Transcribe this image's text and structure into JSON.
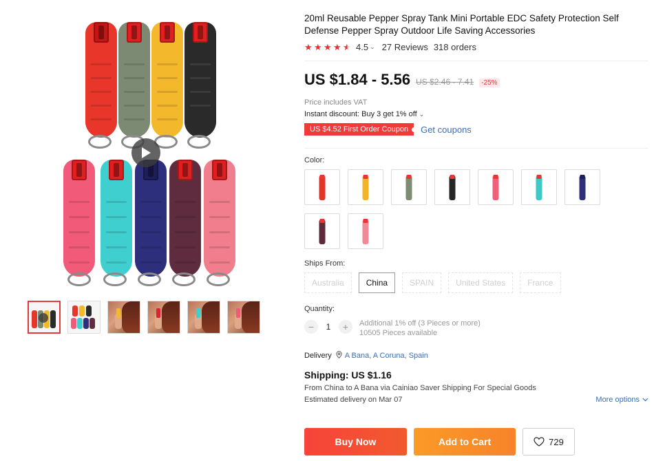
{
  "product": {
    "title": "20ml Reusable Pepper Spray Tank Mini Portable EDC Safety Protection Self Defense Pepper Spray Outdoor Life Saving Accessories",
    "rating": "4.5",
    "rating_stars": 4.5,
    "reviews": "27 Reviews",
    "orders": "318 orders"
  },
  "pricing": {
    "price": "US $1.84 - 5.56",
    "old_price": "US $2.46 - 7.41",
    "discount": "-25%",
    "vat_note": "Price includes VAT",
    "instant_discount": "Instant discount: Buy 3 get 1% off",
    "coupon": "US $4.52 First Order Coupon",
    "get_coupons": "Get coupons"
  },
  "color": {
    "label": "Color:",
    "options": [
      {
        "name": "red",
        "body": "#e3342a"
      },
      {
        "name": "yellow",
        "body": "#f2b52a"
      },
      {
        "name": "gray-green",
        "body": "#7f8a72"
      },
      {
        "name": "black",
        "body": "#262626"
      },
      {
        "name": "pink",
        "body": "#f0607a"
      },
      {
        "name": "turquoise",
        "body": "#3ec9c9"
      },
      {
        "name": "navy",
        "body": "#2e317a"
      },
      {
        "name": "plum",
        "body": "#5c2a3a"
      },
      {
        "name": "light-pink",
        "body": "#f08a96"
      }
    ]
  },
  "ships_from": {
    "label": "Ships From:",
    "options": [
      "Australia",
      "China",
      "SPAIN",
      "United States",
      "France"
    ],
    "selected": "China"
  },
  "quantity": {
    "label": "Quantity:",
    "value": "1",
    "minus": "−",
    "plus": "+",
    "additional": "Additional 1% off (3 Pieces or more)",
    "available": "10505 Pieces available"
  },
  "delivery": {
    "label": "Delivery",
    "destination": "A Bana, A Coruna, Spain",
    "shipping": "Shipping: US $1.16",
    "route": "From China to A Bana via Cainiao Saver Shipping For Special Goods",
    "estimate": "Estimated delivery on Mar 07",
    "more_options": "More options"
  },
  "actions": {
    "buy_now": "Buy Now",
    "add_to_cart": "Add to Cart",
    "wishlist_count": "729"
  },
  "gallery": {
    "main_colors_top": [
      "#e8362b",
      "#7d8a73",
      "#f4b82c",
      "#2a2a2a"
    ],
    "main_colors_bottom": [
      "#f25a7a",
      "#3fcfcf",
      "#2d2f7c",
      "#5e2c3e",
      "#f07e8c"
    ]
  },
  "colors": {
    "accent_red": "#e4393c",
    "link_blue": "#3b6fb6",
    "star_red": "#f02c2c"
  }
}
